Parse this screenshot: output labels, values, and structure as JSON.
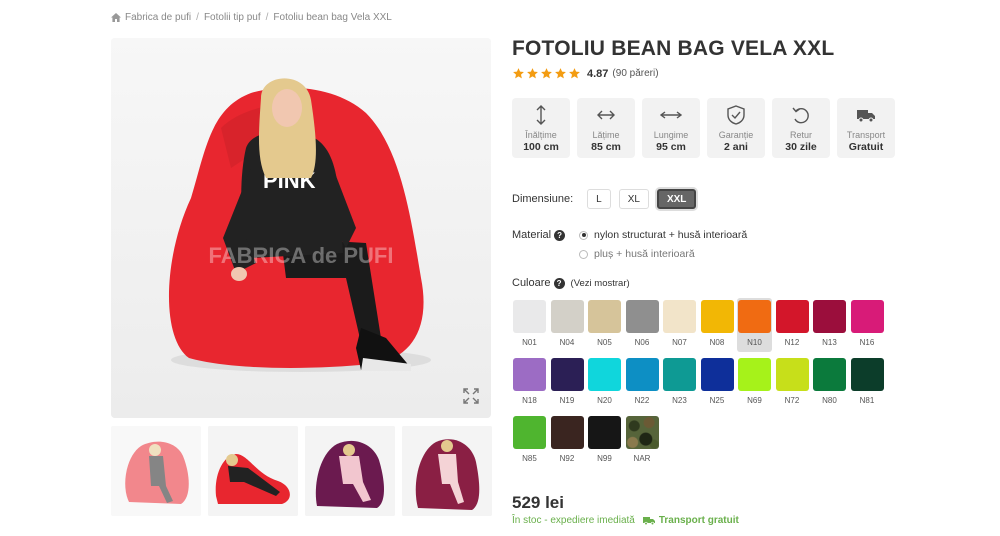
{
  "breadcrumb": {
    "items": [
      "Fabrica de pufi",
      "Fotolii tip puf",
      "Fotoliu bean bag Vela XXL"
    ],
    "separator": "/"
  },
  "gallery": {
    "watermark": "FABRICA de PUFI",
    "thumbnail_count": 4
  },
  "product": {
    "title": "FOTOLIU BEAN BAG VELA XXL",
    "rating": "4.87",
    "rating_value": 4.87,
    "stars": 5,
    "reviews": "(90 păreri)",
    "star_color": "#f39c12"
  },
  "features": [
    {
      "icon": "height-arrow-icon",
      "label": "Înălțime",
      "value": "100 cm"
    },
    {
      "icon": "width-arrow-icon",
      "label": "Lățime",
      "value": "85 cm"
    },
    {
      "icon": "length-arrow-icon",
      "label": "Lungime",
      "value": "95 cm"
    },
    {
      "icon": "shield-check-icon",
      "label": "Garanție",
      "value": "2 ani"
    },
    {
      "icon": "return-arrow-icon",
      "label": "Retur",
      "value": "30 zile"
    },
    {
      "icon": "truck-icon",
      "label": "Transport",
      "value": "Gratuit"
    }
  ],
  "dimension": {
    "label": "Dimensiune:",
    "options": [
      "L",
      "XL",
      "XXL"
    ],
    "selected": "XXL"
  },
  "material": {
    "label": "Material",
    "options": [
      "nylon structurat + husă interioară",
      "pluș + husă interioară"
    ],
    "selected": "nylon structurat + husă interioară"
  },
  "colors": {
    "label": "Culoare",
    "link": "(Vezi mostrar)",
    "selected": "N10",
    "items": [
      {
        "code": "N01",
        "hex": "#e9e9ea"
      },
      {
        "code": "N04",
        "hex": "#d3d0c8"
      },
      {
        "code": "N05",
        "hex": "#d6c49a"
      },
      {
        "code": "N06",
        "hex": "#8f8f8f"
      },
      {
        "code": "N07",
        "hex": "#f2e4c9"
      },
      {
        "code": "N08",
        "hex": "#f2b705"
      },
      {
        "code": "N10",
        "hex": "#f06b12"
      },
      {
        "code": "N12",
        "hex": "#d3162a"
      },
      {
        "code": "N13",
        "hex": "#9b0e3c"
      },
      {
        "code": "N16",
        "hex": "#d81b78"
      },
      {
        "code": "N18",
        "hex": "#9c6cc4"
      },
      {
        "code": "N19",
        "hex": "#2b1f55"
      },
      {
        "code": "N20",
        "hex": "#10d6dc"
      },
      {
        "code": "N22",
        "hex": "#0d8fc4"
      },
      {
        "code": "N23",
        "hex": "#0e9a94"
      },
      {
        "code": "N25",
        "hex": "#0e2f9a"
      },
      {
        "code": "N69",
        "hex": "#a6f21a"
      },
      {
        "code": "N72",
        "hex": "#c7df1a"
      },
      {
        "code": "N80",
        "hex": "#0b7a3c"
      },
      {
        "code": "N81",
        "hex": "#0c3d2a"
      },
      {
        "code": "N85",
        "hex": "#4fb52f"
      },
      {
        "code": "N92",
        "hex": "#3a2520"
      },
      {
        "code": "N99",
        "hex": "#161616"
      },
      {
        "code": "NAR",
        "hex": "camo"
      }
    ]
  },
  "price": "529 lei",
  "stock": {
    "status": "În stoc - expediere imediată",
    "shipping": "Transport gratuit",
    "color": "#6ab04c"
  }
}
